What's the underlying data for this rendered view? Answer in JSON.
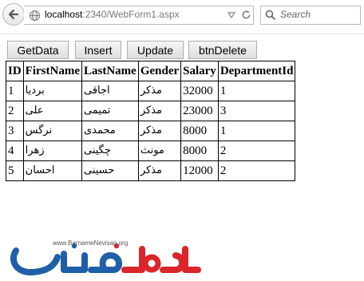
{
  "browser": {
    "url_host": "localhost",
    "url_path": ":2340/WebForm1.aspx",
    "search_placeholder": "Search"
  },
  "buttons": {
    "getdata": "GetData",
    "insert": "Insert",
    "update": "Update",
    "delete": "btnDelete"
  },
  "table": {
    "headers": [
      "ID",
      "FirstName",
      "LastName",
      "Gender",
      "Salary",
      "DepartmentId"
    ],
    "rows": [
      [
        "1",
        "بردیا",
        "اجاقی",
        "مذکر",
        "32000",
        "1"
      ],
      [
        "2",
        "علی",
        "تمیمی",
        "مذکر",
        "23000",
        "3"
      ],
      [
        "3",
        "نرگس",
        "محمدی",
        "مذکر",
        "8000",
        "1"
      ],
      [
        "4",
        "زهرا",
        "چگینی",
        "مونث",
        "8000",
        "2"
      ],
      [
        "5",
        "احسان",
        "حسینی",
        "مذکر",
        "12000",
        "2"
      ]
    ]
  },
  "logo": {
    "url_text": "www.BarnameNevisan.org",
    "colors": {
      "blue": "#1f5fa8",
      "red": "#d9252b"
    }
  }
}
